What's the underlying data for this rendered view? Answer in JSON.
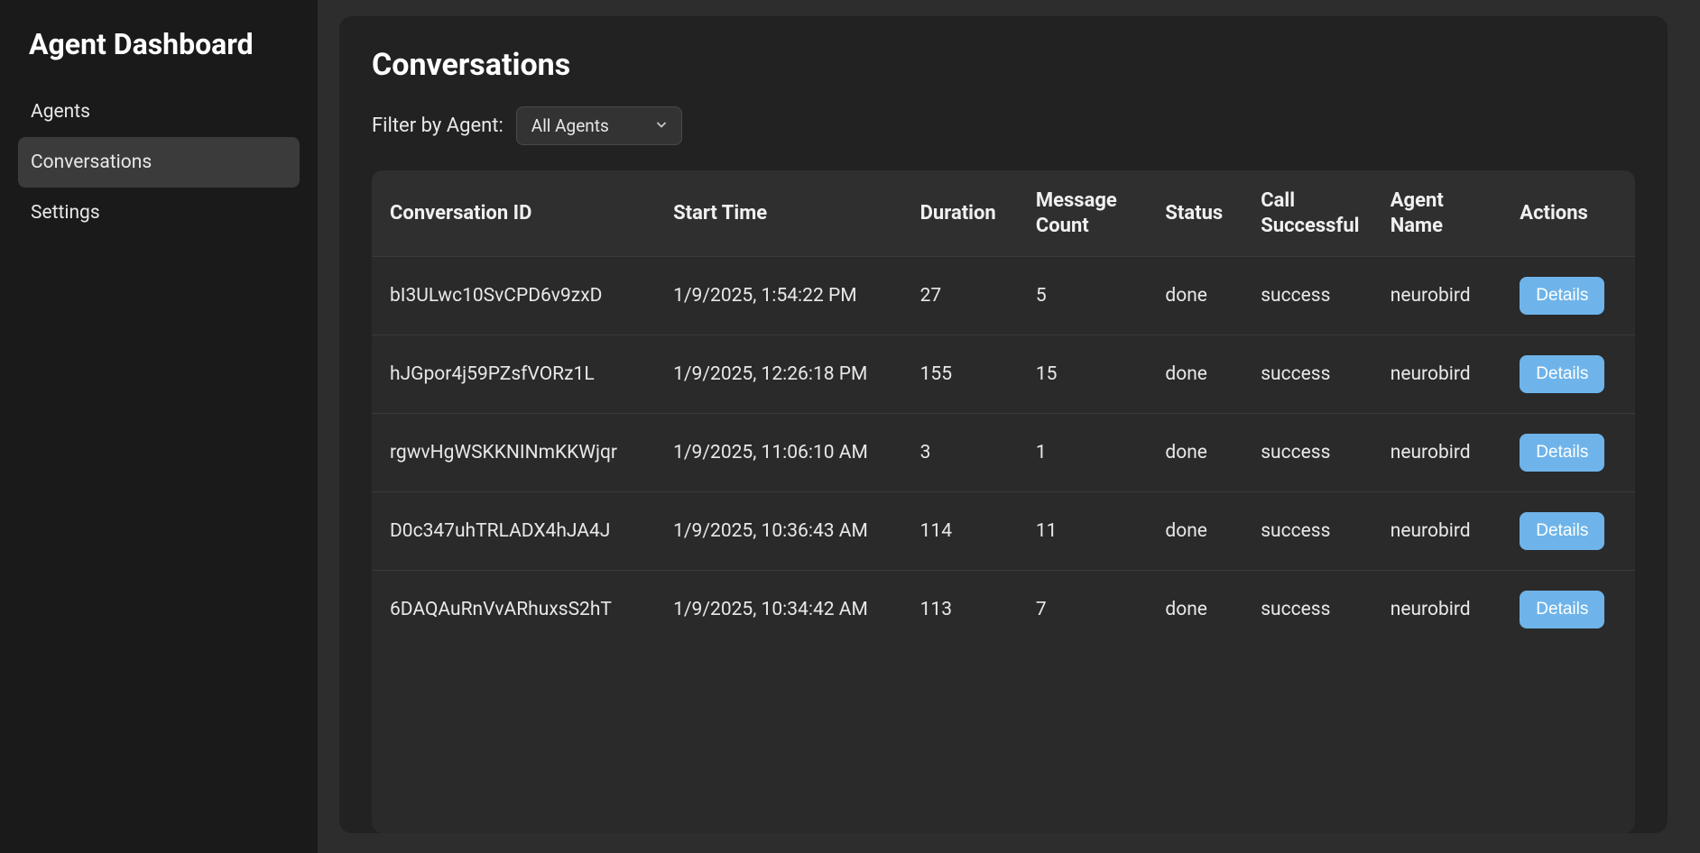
{
  "sidebar": {
    "title": "Agent Dashboard",
    "items": [
      {
        "label": "Agents"
      },
      {
        "label": "Conversations"
      },
      {
        "label": "Settings"
      }
    ],
    "activeIndex": 1
  },
  "page": {
    "title": "Conversations"
  },
  "filter": {
    "label": "Filter by Agent:",
    "selected": "All Agents"
  },
  "table": {
    "columns": [
      "Conversation ID",
      "Start Time",
      "Duration",
      "Message Count",
      "Status",
      "Call Successful",
      "Agent Name",
      "Actions"
    ],
    "actionLabel": "Details",
    "rows": [
      {
        "id": "bI3ULwc10SvCPD6v9zxD",
        "start": "1/9/2025, 1:54:22 PM",
        "duration": "27",
        "msgCount": "5",
        "status": "done",
        "callSuccess": "success",
        "agent": "neurobird"
      },
      {
        "id": "hJGpor4j59PZsfVORz1L",
        "start": "1/9/2025, 12:26:18 PM",
        "duration": "155",
        "msgCount": "15",
        "status": "done",
        "callSuccess": "success",
        "agent": "neurobird"
      },
      {
        "id": "rgwvHgWSKKNINmKKWjqr",
        "start": "1/9/2025, 11:06:10 AM",
        "duration": "3",
        "msgCount": "1",
        "status": "done",
        "callSuccess": "success",
        "agent": "neurobird"
      },
      {
        "id": "D0c347uhTRLADX4hJA4J",
        "start": "1/9/2025, 10:36:43 AM",
        "duration": "114",
        "msgCount": "11",
        "status": "done",
        "callSuccess": "success",
        "agent": "neurobird"
      },
      {
        "id": "6DAQAuRnVvARhuxsS2hT",
        "start": "1/9/2025, 10:34:42 AM",
        "duration": "113",
        "msgCount": "7",
        "status": "done",
        "callSuccess": "success",
        "agent": "neurobird"
      }
    ]
  }
}
